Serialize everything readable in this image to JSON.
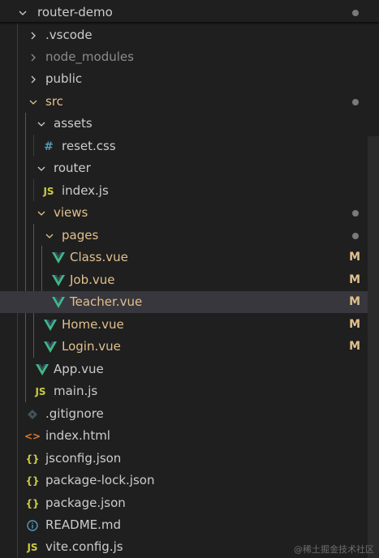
{
  "explorer": {
    "root": {
      "label": "router-demo"
    },
    "items": {
      "vscode": {
        "label": ".vscode"
      },
      "node_modules": {
        "label": "node_modules"
      },
      "public": {
        "label": "public"
      },
      "src": {
        "label": "src"
      },
      "assets": {
        "label": "assets"
      },
      "reset_css": {
        "label": "reset.css",
        "icon": "#"
      },
      "router": {
        "label": "router"
      },
      "router_index_js": {
        "label": "index.js",
        "icon": "JS"
      },
      "views": {
        "label": "views"
      },
      "pages": {
        "label": "pages"
      },
      "class_vue": {
        "label": "Class.vue",
        "badge": "M"
      },
      "job_vue": {
        "label": "Job.vue",
        "badge": "M"
      },
      "teacher_vue": {
        "label": "Teacher.vue",
        "badge": "M"
      },
      "home_vue": {
        "label": "Home.vue",
        "badge": "M"
      },
      "login_vue": {
        "label": "Login.vue",
        "badge": "M"
      },
      "app_vue": {
        "label": "App.vue"
      },
      "main_js": {
        "label": "main.js",
        "icon": "JS"
      },
      "gitignore": {
        "label": ".gitignore"
      },
      "index_html": {
        "label": "index.html",
        "icon": "<>"
      },
      "jsconfig_json": {
        "label": "jsconfig.json",
        "icon": "{}"
      },
      "package_lock_json": {
        "label": "package-lock.json",
        "icon": "{}"
      },
      "package_json": {
        "label": "package.json",
        "icon": "{}"
      },
      "readme_md": {
        "label": "README.md",
        "icon": "i"
      },
      "vite_config_js": {
        "label": "vite.config.js",
        "icon": "JS"
      }
    }
  },
  "colors": {
    "background": "#1f1f1f",
    "selected_row": "#37373d",
    "modified": "#e2c08d",
    "vue": "#41b883",
    "js": "#cbcb41",
    "css": "#519aba",
    "html": "#e37933",
    "json": "#cbcb41",
    "info": "#519aba",
    "ignored_text": "#8c8c8c"
  },
  "watermark": "@稀土掘金技术社区"
}
